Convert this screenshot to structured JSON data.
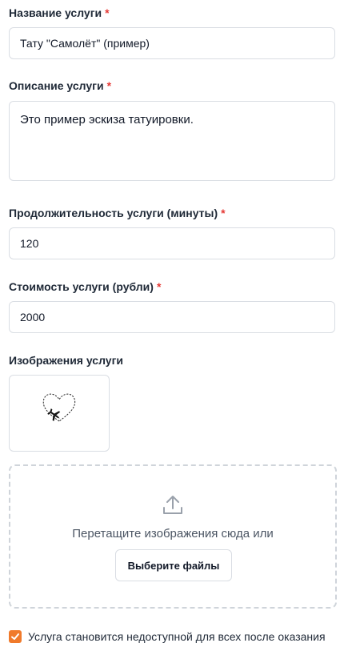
{
  "form": {
    "name": {
      "label": "Название услуги",
      "required_mark": "*",
      "value": "Тату \"Самолёт\" (пример)"
    },
    "description": {
      "label": "Описание услуги",
      "required_mark": "*",
      "value": "Это пример эскиза татуировки."
    },
    "duration": {
      "label": "Продолжительность услуги (минуты)",
      "required_mark": "*",
      "value": "120"
    },
    "price": {
      "label": "Стоимость услуги (рубли)",
      "required_mark": "*",
      "value": "2000"
    },
    "images": {
      "label": "Изображения услуги",
      "thumbnail_icon": "dashed-heart-airplane-sketch",
      "dropzone_text": "Перетащите изображения сюда или",
      "upload_icon": "upload-icon",
      "choose_button": "Выберите файлы"
    },
    "unavailable_after_booking": {
      "label": "Услуга становится недоступной для всех после оказания",
      "checked": true
    }
  },
  "colors": {
    "accent": "#f07a2b",
    "required": "#e53935",
    "border": "#d9dde3"
  }
}
